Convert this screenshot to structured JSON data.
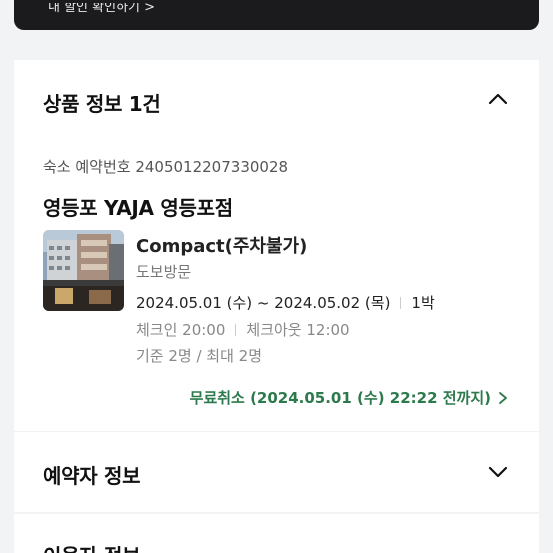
{
  "banner": {
    "text": "내 할인 확인하기 >"
  },
  "product_section": {
    "title": "상품 정보 1건",
    "reservation_number": "숙소 예약번호 2405012207330028",
    "hotel_name": "영등포 YAJA 영등포점",
    "room_name": "Compact(주차불가)",
    "access_type": "도보방문",
    "dates": "2024.05.01 (수) ~ 2024.05.02 (목)",
    "nights": "1박",
    "checkin": "체크인 20:00",
    "checkout": "체크아웃 12:00",
    "guests": "기준 2명 / 최대 2명",
    "free_cancel": "무료취소 (2024.05.01 (수) 22:22 전까지)"
  },
  "booker_section": {
    "title": "예약자 정보"
  },
  "user_section": {
    "title": "이용자 정보"
  },
  "icons": {
    "product_toggle": "chevron-up-icon",
    "booker_toggle": "chevron-down-icon",
    "cancel_link": "chevron-right-icon"
  },
  "colors": {
    "accent_green": "#2c7a4b",
    "banner_bg": "#1b1b1d",
    "page_bg": "#f2f3f5"
  }
}
